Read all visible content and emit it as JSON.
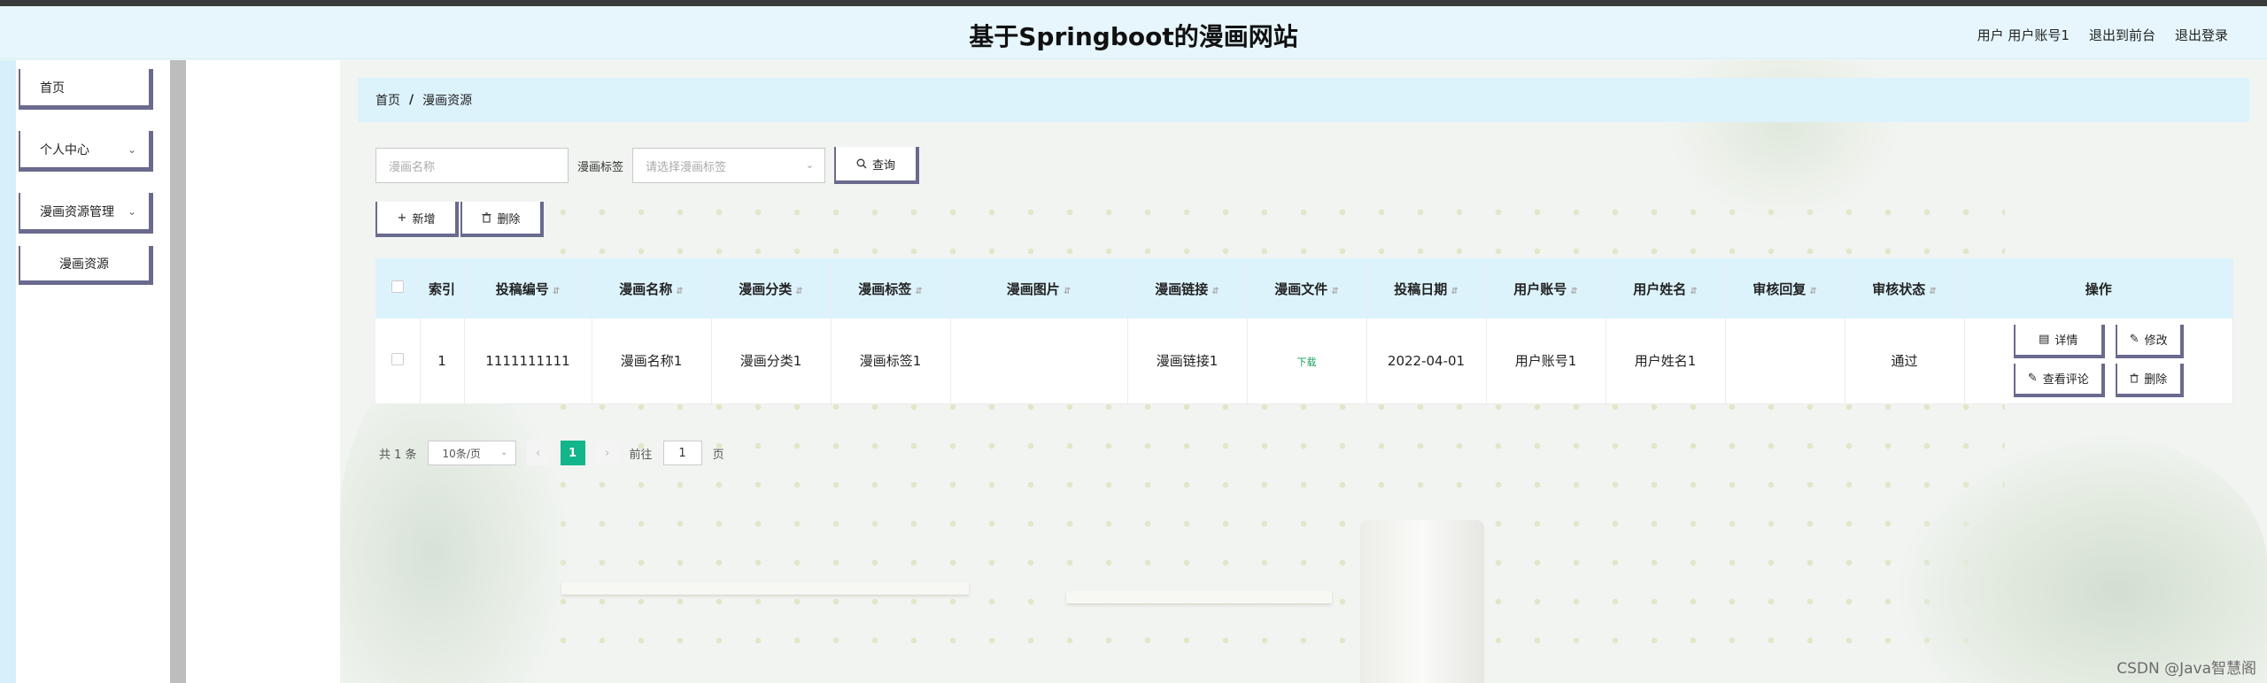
{
  "header": {
    "title": "基于Springboot的漫画网站",
    "user_label": "用户 用户账号1",
    "back_front": "退出到前台",
    "logout": "退出登录"
  },
  "sidebar": {
    "items": [
      {
        "label": "首页"
      },
      {
        "label": "个人中心"
      },
      {
        "label": "漫画资源管理"
      },
      {
        "label": "漫画资源"
      }
    ]
  },
  "breadcrumb": {
    "home": "首页",
    "separator": "/",
    "current": "漫画资源"
  },
  "search": {
    "name_placeholder": "漫画名称",
    "tag_label": "漫画标签",
    "tag_placeholder": "请选择漫画标签",
    "query_label": "查询"
  },
  "actions": {
    "add_label": "新增",
    "delete_label": "删除"
  },
  "table": {
    "headers": [
      "索引",
      "投稿编号",
      "漫画名称",
      "漫画分类",
      "漫画标签",
      "漫画图片",
      "漫画链接",
      "漫画文件",
      "投稿日期",
      "用户账号",
      "用户姓名",
      "审核回复",
      "审核状态",
      "操作"
    ],
    "rows": [
      {
        "index": "1",
        "submission_no": "1111111111",
        "name": "漫画名称1",
        "category": "漫画分类1",
        "tag": "漫画标签1",
        "image": "",
        "link": "漫画链接1",
        "file": "下载",
        "date": "2022-04-01",
        "account": "用户账号1",
        "username": "用户姓名1",
        "reply": "",
        "status": "通过"
      }
    ],
    "row_actions": {
      "detail": "详情",
      "edit": "修改",
      "comments": "查看评论",
      "delete": "删除"
    }
  },
  "pagination": {
    "total": "共 1 条",
    "page_size": "10条/页",
    "current_page": "1",
    "goto_prefix": "前往",
    "goto_value": "1",
    "goto_suffix": "页"
  },
  "watermark": "CSDN @Java智慧阁",
  "colors": {
    "header_bg": "#e6f6fc",
    "table_header_bg": "#dcf3fc",
    "button_border": "#6a6a8e",
    "page_active": "#13b58a",
    "download_link": "#18a058"
  }
}
